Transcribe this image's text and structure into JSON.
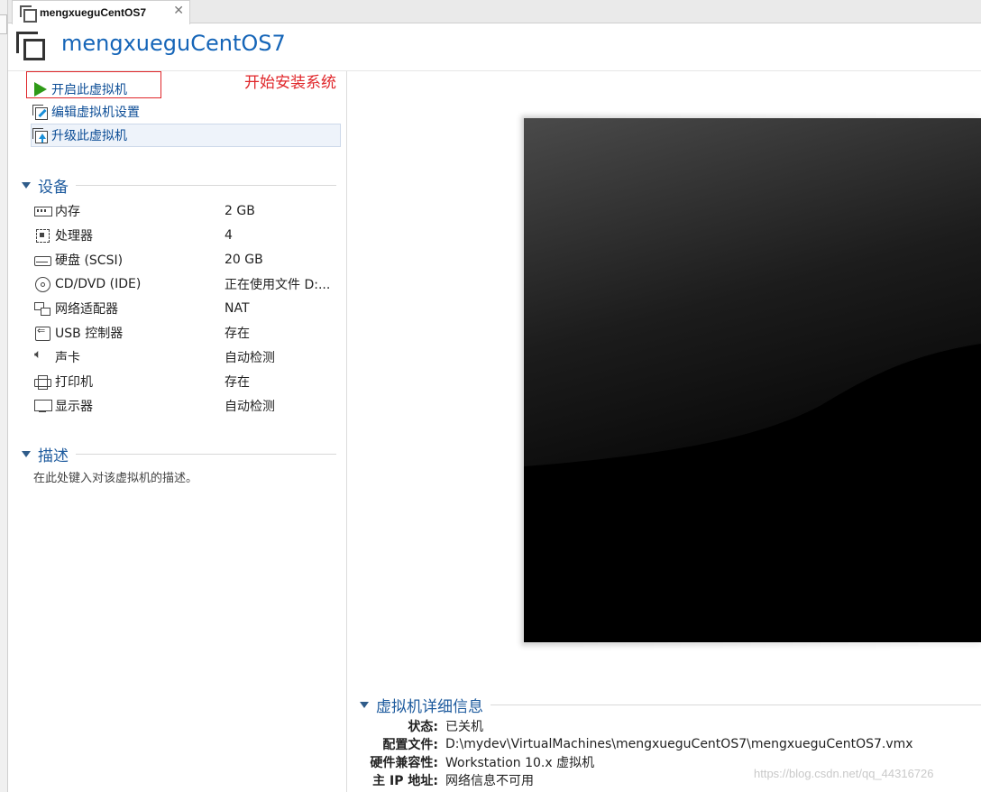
{
  "tab": {
    "label": "mengxueguCentOS7",
    "close_glyph": "✕"
  },
  "vm": {
    "title": "mengxueguCentOS7"
  },
  "actions": {
    "power_on": "开启此虚拟机",
    "edit_settings": "编辑虚拟机设置",
    "upgrade": "升级此虚拟机"
  },
  "annotation": {
    "text": "开始安装系统",
    "color": "#e0262a"
  },
  "devices": {
    "header": "设备",
    "items": [
      {
        "icon": "memory-icon",
        "name": "内存",
        "value": "2 GB"
      },
      {
        "icon": "processor-icon",
        "name": "处理器",
        "value": "4"
      },
      {
        "icon": "hard-disk-icon",
        "name": "硬盘 (SCSI)",
        "value": "20 GB"
      },
      {
        "icon": "cd-dvd-icon",
        "name": "CD/DVD (IDE)",
        "value": "正在使用文件 D:..."
      },
      {
        "icon": "network-adapter-icon",
        "name": "网络适配器",
        "value": "NAT"
      },
      {
        "icon": "usb-controller-icon",
        "name": "USB 控制器",
        "value": "存在"
      },
      {
        "icon": "sound-card-icon",
        "name": "声卡",
        "value": "自动检测"
      },
      {
        "icon": "printer-icon",
        "name": "打印机",
        "value": "存在"
      },
      {
        "icon": "display-icon",
        "name": "显示器",
        "value": "自动检测"
      }
    ]
  },
  "description": {
    "header": "描述",
    "placeholder": "在此处键入对该虚拟机的描述。"
  },
  "details": {
    "header": "虚拟机详细信息",
    "rows": [
      {
        "key": "状态:",
        "value": "已关机"
      },
      {
        "key": "配置文件:",
        "value": "D:\\mydev\\VirtualMachines\\mengxueguCentOS7\\mengxueguCentOS7.vmx"
      },
      {
        "key": "硬件兼容性:",
        "value": "Workstation 10.x 虚拟机"
      },
      {
        "key": "主 IP 地址:",
        "value": "网络信息不可用"
      }
    ]
  },
  "watermark": "https://blog.csdn.net/qq_44316726",
  "colors": {
    "accent": "#1565b8",
    "section": "#1e5b9e",
    "play": "#2e9a17"
  }
}
